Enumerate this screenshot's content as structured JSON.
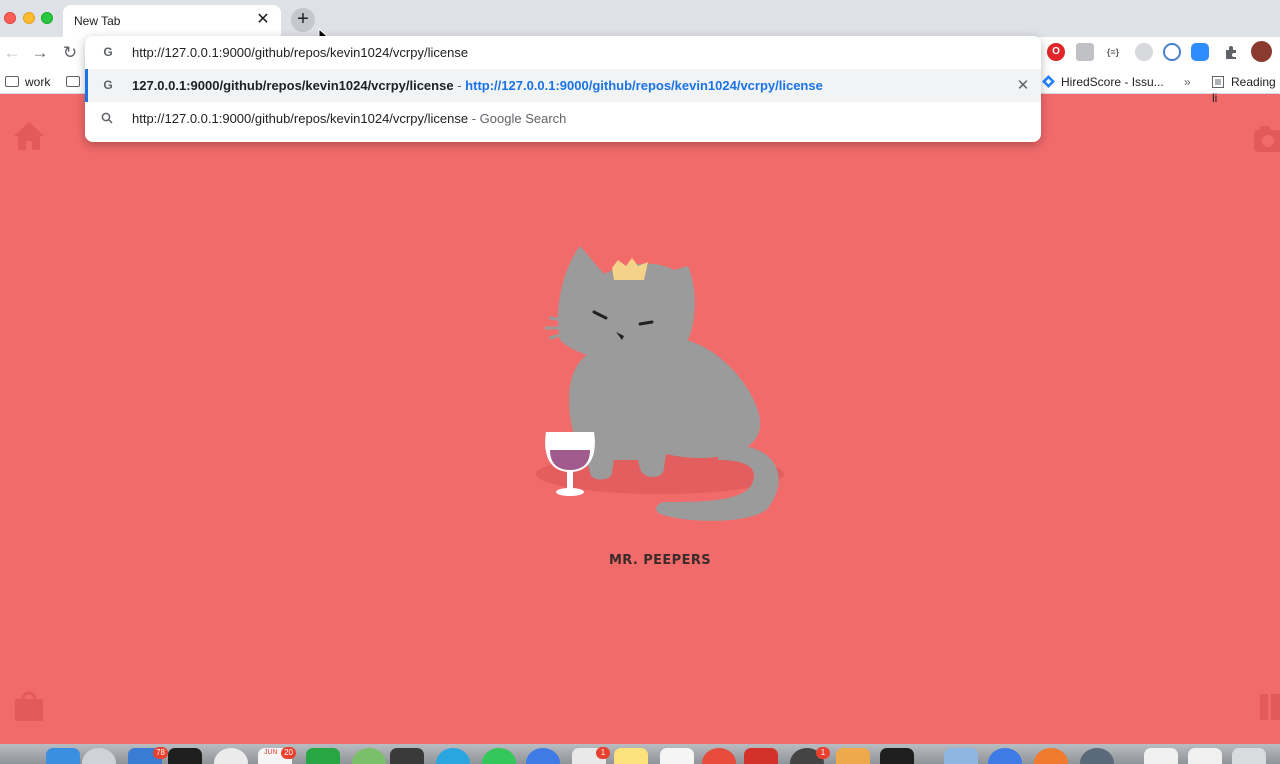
{
  "browser": {
    "tab": {
      "title": "New Tab",
      "close": "✕"
    },
    "new_tab": "+",
    "nav": {
      "back": "←",
      "forward": "→",
      "reload": "↻"
    }
  },
  "bookmarks": {
    "work": "work",
    "hiredscore": "HiredScore - Issu...",
    "overflow": "»",
    "reading_list": "Reading li"
  },
  "omnibox": {
    "input_value": "http://127.0.0.1:9000/github/repos/kevin1024/vcrpy/license",
    "suggestions": [
      {
        "title": "127.0.0.1:9000/github/repos/kevin1024/vcrpy/license",
        "separator": "-",
        "url": "http://127.0.0.1:9000/github/repos/kevin1024/vcrpy/license",
        "remove": "✕"
      },
      {
        "query": "http://127.0.0.1:9000/github/repos/kevin1024/vcrpy/license",
        "separator": "-",
        "suffix": "Google Search"
      }
    ]
  },
  "page": {
    "character_name": "MR. PEEPERS",
    "background_color": "#f26b6b",
    "cat_color": "#9b9b9b",
    "wine_color": "#a05a8c"
  },
  "dock": {
    "badges": [
      "78",
      "20",
      "1",
      "1"
    ],
    "calendar_month": "JUN",
    "calendar_day": "20"
  }
}
